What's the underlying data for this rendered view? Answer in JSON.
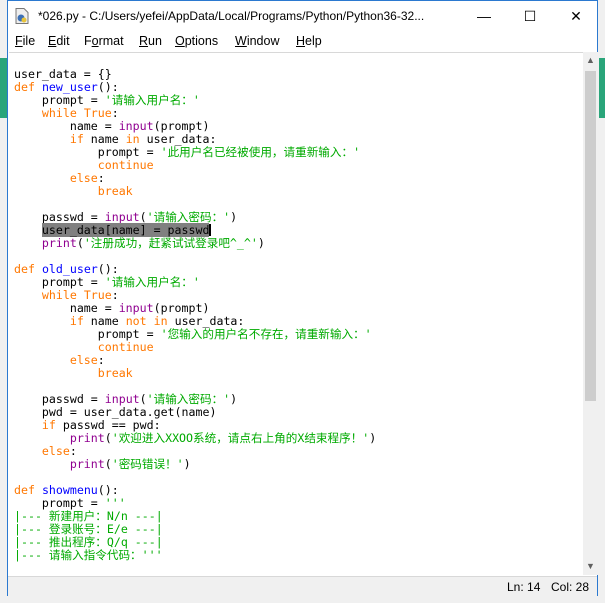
{
  "window": {
    "title": "*026.py - C:/Users/yefei/AppData/Local/Programs/Python/Python36-32...",
    "controls": {
      "minimize": "—",
      "maximize": "☐",
      "close": "✕"
    }
  },
  "menu": [
    {
      "pre": "",
      "accel": "F",
      "rest": "ile"
    },
    {
      "pre": "",
      "accel": "E",
      "rest": "dit"
    },
    {
      "pre": "F",
      "accel": "o",
      "rest": "rmat"
    },
    {
      "pre": "",
      "accel": "R",
      "rest": "un"
    },
    {
      "pre": "",
      "accel": "O",
      "rest": "ptions"
    },
    {
      "pre": "",
      "accel": "W",
      "rest": "indow"
    },
    {
      "pre": "",
      "accel": "H",
      "rest": "elp"
    }
  ],
  "scrollbar": {
    "up": "▲",
    "down": "▼"
  },
  "colors": {
    "keyword": "#ff7700",
    "definition": "#0000ff",
    "string": "#00aa00",
    "builtin": "#900090",
    "selection": "#808080"
  },
  "code": [
    [
      [
        "pl",
        "user_data = {}"
      ]
    ],
    [
      [
        "kw",
        "def"
      ],
      [
        "pl",
        " "
      ],
      [
        "def",
        "new_user"
      ],
      [
        "pl",
        "():"
      ]
    ],
    [
      [
        "pl",
        "    prompt = "
      ],
      [
        "str",
        "'请输入用户名：'"
      ]
    ],
    [
      [
        "pl",
        "    "
      ],
      [
        "kw",
        "while"
      ],
      [
        "pl",
        " "
      ],
      [
        "kw",
        "True"
      ],
      [
        "pl",
        ":"
      ]
    ],
    [
      [
        "pl",
        "        name = "
      ],
      [
        "bi",
        "input"
      ],
      [
        "pl",
        "(prompt)"
      ]
    ],
    [
      [
        "pl",
        "        "
      ],
      [
        "kw",
        "if"
      ],
      [
        "pl",
        " name "
      ],
      [
        "kw",
        "in"
      ],
      [
        "pl",
        " user_data:"
      ]
    ],
    [
      [
        "pl",
        "            prompt = "
      ],
      [
        "str",
        "'此用户名已经被使用，请重新输入：'"
      ]
    ],
    [
      [
        "pl",
        "            "
      ],
      [
        "kw",
        "continue"
      ]
    ],
    [
      [
        "pl",
        "        "
      ],
      [
        "kw",
        "else"
      ],
      [
        "pl",
        ":"
      ]
    ],
    [
      [
        "pl",
        "            "
      ],
      [
        "kw",
        "break"
      ]
    ],
    [],
    [
      [
        "pl",
        "    passwd = "
      ],
      [
        "bi",
        "input"
      ],
      [
        "pl",
        "("
      ],
      [
        "str",
        "'请输入密码：'"
      ],
      [
        "pl",
        ")"
      ]
    ],
    [
      [
        "pl",
        "    "
      ],
      [
        "sel",
        "user_data[name] = passwd"
      ],
      [
        "caret",
        ""
      ]
    ],
    [
      [
        "pl",
        "    "
      ],
      [
        "bi",
        "print"
      ],
      [
        "pl",
        "("
      ],
      [
        "str",
        "'注册成功，赶紧试试登录吧^_^'"
      ],
      [
        "pl",
        ")"
      ]
    ],
    [],
    [
      [
        "kw",
        "def"
      ],
      [
        "pl",
        " "
      ],
      [
        "def",
        "old_user"
      ],
      [
        "pl",
        "():"
      ]
    ],
    [
      [
        "pl",
        "    prompt = "
      ],
      [
        "str",
        "'请输入用户名：'"
      ]
    ],
    [
      [
        "pl",
        "    "
      ],
      [
        "kw",
        "while"
      ],
      [
        "pl",
        " "
      ],
      [
        "kw",
        "True"
      ],
      [
        "pl",
        ":"
      ]
    ],
    [
      [
        "pl",
        "        name = "
      ],
      [
        "bi",
        "input"
      ],
      [
        "pl",
        "(prompt)"
      ]
    ],
    [
      [
        "pl",
        "        "
      ],
      [
        "kw",
        "if"
      ],
      [
        "pl",
        " name "
      ],
      [
        "kw",
        "not"
      ],
      [
        "pl",
        " "
      ],
      [
        "kw",
        "in"
      ],
      [
        "pl",
        " user_data:"
      ]
    ],
    [
      [
        "pl",
        "            prompt = "
      ],
      [
        "str",
        "'您输入的用户名不存在，请重新输入：'"
      ]
    ],
    [
      [
        "pl",
        "            "
      ],
      [
        "kw",
        "continue"
      ]
    ],
    [
      [
        "pl",
        "        "
      ],
      [
        "kw",
        "else"
      ],
      [
        "pl",
        ":"
      ]
    ],
    [
      [
        "pl",
        "            "
      ],
      [
        "kw",
        "break"
      ]
    ],
    [],
    [
      [
        "pl",
        "    passwd = "
      ],
      [
        "bi",
        "input"
      ],
      [
        "pl",
        "("
      ],
      [
        "str",
        "'请输入密码：'"
      ],
      [
        "pl",
        ")"
      ]
    ],
    [
      [
        "pl",
        "    pwd = user_data.get(name)"
      ]
    ],
    [
      [
        "pl",
        "    "
      ],
      [
        "kw",
        "if"
      ],
      [
        "pl",
        " passwd == pwd:"
      ]
    ],
    [
      [
        "pl",
        "        "
      ],
      [
        "bi",
        "print"
      ],
      [
        "pl",
        "("
      ],
      [
        "str",
        "'欢迎进入XXOO系统，请点右上角的X结束程序！'"
      ],
      [
        "pl",
        ")"
      ]
    ],
    [
      [
        "pl",
        "    "
      ],
      [
        "kw",
        "else"
      ],
      [
        "pl",
        ":"
      ]
    ],
    [
      [
        "pl",
        "        "
      ],
      [
        "bi",
        "print"
      ],
      [
        "pl",
        "("
      ],
      [
        "str",
        "'密码错误！'"
      ],
      [
        "pl",
        ")"
      ]
    ],
    [],
    [
      [
        "kw",
        "def"
      ],
      [
        "pl",
        " "
      ],
      [
        "def",
        "showmenu"
      ],
      [
        "pl",
        "():"
      ]
    ],
    [
      [
        "pl",
        "    prompt = "
      ],
      [
        "str",
        "'''"
      ]
    ],
    [
      [
        "str",
        "|--- 新建用户：N/n ---|"
      ]
    ],
    [
      [
        "str",
        "|--- 登录账号：E/e ---|"
      ]
    ],
    [
      [
        "str",
        "|--- 推出程序：Q/q ---|"
      ]
    ],
    [
      [
        "str",
        "|--- 请输入指令代码：'''"
      ]
    ]
  ],
  "status": {
    "line": "Ln: 14",
    "col": "Col: 28"
  }
}
